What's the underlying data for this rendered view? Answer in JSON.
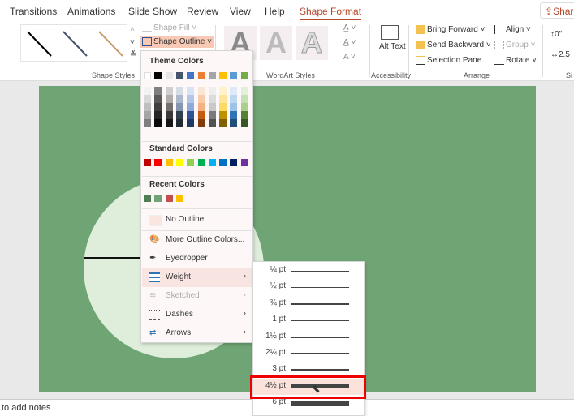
{
  "tabs": [
    "Transitions",
    "Animations",
    "Slide Show",
    "Review",
    "View",
    "Help",
    "Shape Format"
  ],
  "share_label": "Share",
  "ribbon": {
    "shape_fill": "Shape Fill",
    "shape_outline": "Shape Outline",
    "shape_styles": "Shape Styles",
    "wordart_styles": "WordArt Styles",
    "wordart_letter": "A",
    "alt_text": "Alt Text",
    "accessibility": "Accessibility",
    "bring_forward": "Bring Forward",
    "send_backward": "Send Backward",
    "selection_pane": "Selection Pane",
    "align": "Align",
    "group": "Group",
    "rotate": "Rotate",
    "arrange": "Arrange",
    "height": "0\"",
    "width": "2.5",
    "size": "Si"
  },
  "menu": {
    "theme_colors": "Theme Colors",
    "theme_row": [
      "#ffffff",
      "#000000",
      "#e7e6e6",
      "#44546a",
      "#4472c4",
      "#ed7d31",
      "#a5a5a5",
      "#ffc000",
      "#5b9bd5",
      "#70ad47"
    ],
    "theme_shades": [
      [
        "#f2f2f2",
        "#7f7f7f",
        "#d0cece",
        "#d6dce4",
        "#d9e2f3",
        "#fbe5d5",
        "#ededed",
        "#fff2cc",
        "#deebf6",
        "#e2efd9"
      ],
      [
        "#d8d8d8",
        "#595959",
        "#aeabab",
        "#adb9ca",
        "#b4c6e7",
        "#f7cbac",
        "#dbdbdb",
        "#fee599",
        "#bdd7ee",
        "#c5e0b3"
      ],
      [
        "#bfbfbf",
        "#3f3f3f",
        "#757070",
        "#8496b0",
        "#8eaadb",
        "#f4b183",
        "#c9c9c9",
        "#ffd965",
        "#9dc3e6",
        "#a8d08d"
      ],
      [
        "#a5a5a5",
        "#262626",
        "#3a3838",
        "#323f4f",
        "#2f5496",
        "#c55a11",
        "#7b7b7b",
        "#bf9000",
        "#2e75b5",
        "#538135"
      ],
      [
        "#7f7f7f",
        "#0c0c0c",
        "#171616",
        "#222a35",
        "#1f3864",
        "#833c0b",
        "#525252",
        "#7f6000",
        "#1e4e79",
        "#375623"
      ]
    ],
    "standard_colors": "Standard Colors",
    "standard_row": [
      "#c00000",
      "#ff0000",
      "#ffc000",
      "#ffff00",
      "#92d050",
      "#00b050",
      "#00b0f0",
      "#0070c0",
      "#002060",
      "#7030a0"
    ],
    "recent_colors": "Recent Colors",
    "recent_row": [
      "#4e7f52",
      "#6fa574",
      "#c0504d",
      "#ffc000"
    ],
    "items": [
      "No Outline",
      "More Outline Colors...",
      "Eyedropper",
      "Weight",
      "Sketched",
      "Dashes",
      "Arrows"
    ]
  },
  "weights": [
    "¼ pt",
    "½ pt",
    "¾ pt",
    "1 pt",
    "1½ pt",
    "2¼ pt",
    "3 pt",
    "4½ pt",
    "6 pt"
  ],
  "weight_selected": "4½ pt",
  "notes": "to add notes"
}
